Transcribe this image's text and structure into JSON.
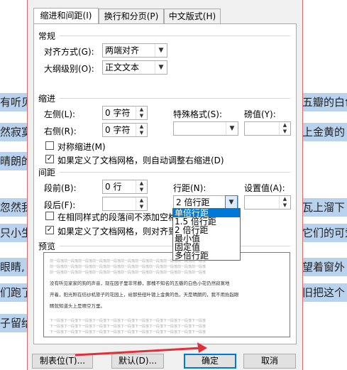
{
  "background_doc": {
    "left_fragments": [
      "有听见",
      "然寂寞",
      "晴朗的",
      "忽然我",
      "只小生",
      "眼睛,",
      "们跑了",
      "子留给"
    ],
    "right_fragments": [
      "五瓣的白色",
      "上金黄的",
      "",
      "瓦上溜下",
      "它们的可爱",
      "望着窗外",
      "旧把这个",
      ""
    ]
  },
  "dialog": {
    "tabs": [
      "缩进和间距(I)",
      "换行和分页(P)",
      "中文版式(H)"
    ],
    "general": {
      "title": "常规",
      "alignment_label": "对齐方式(G):",
      "alignment_value": "两端对齐",
      "outline_label": "大纲级别(O):",
      "outline_value": "正文文本"
    },
    "indent": {
      "title": "缩进",
      "left_label": "左侧(L):",
      "left_value": "0 字符",
      "right_label": "右侧(R):",
      "right_value": "0 字符",
      "special_label": "特殊格式(S):",
      "special_value": "",
      "by_label": "磅值(Y):",
      "by_value": "",
      "mirror_label": "对称缩进(M)",
      "mirror_checked": false,
      "auto_adjust_label": "如果定义了文档网格，则自动调整右缩进(D)",
      "auto_adjust_checked": true
    },
    "spacing": {
      "title": "间距",
      "before_label": "段前(B):",
      "before_value": "0 行",
      "after_label": "段后(F):",
      "after_value": "",
      "line_label": "行距(N):",
      "line_value": "2 倍行距",
      "at_label": "设置值(A):",
      "at_value": "",
      "no_space_label": "在相同样式的段落间不添加空格",
      "no_space_checked": false,
      "snap_grid_label": "如果定义了文档网格，则对齐到",
      "snap_grid_checked": true,
      "line_options": [
        "单倍行距",
        "1.5 倍行距",
        "2 倍行距",
        "最小值",
        "固定值",
        "多倍行距"
      ],
      "line_selected_index": 0
    },
    "preview": {
      "title": "预览",
      "grey_prev": "前一段落前一段落前一段落前一段落前一段落前一段落前一段落前一段落前一段落前一段落前一段落",
      "main_line1": "没有听见家家的狗的声音，现在园子里非常静，那槐不知名的五瓣的白色小花仍然寂寞地",
      "main_line2": "开着，阳光照在纺纱机旅子的花园上，给那些纽叶镀上金黄的色，天是晴朗的，我不用抬起眼",
      "main_line3": "睛就知道头上是晴空万里。",
      "grey_next": "下一段落下一段落下一段落下一段落下一段落下一段落下一段落下一段落下一段落下一段落下一段落"
    },
    "buttons": {
      "tabs_label": "制表位(T)...",
      "default_label": "默认(D)...",
      "ok_label": "确定",
      "cancel_label": "取消"
    }
  },
  "colors": {
    "highlight": "#b9d3ee",
    "selection": "#0078d7",
    "annotation_arrow": "#e0303a"
  }
}
